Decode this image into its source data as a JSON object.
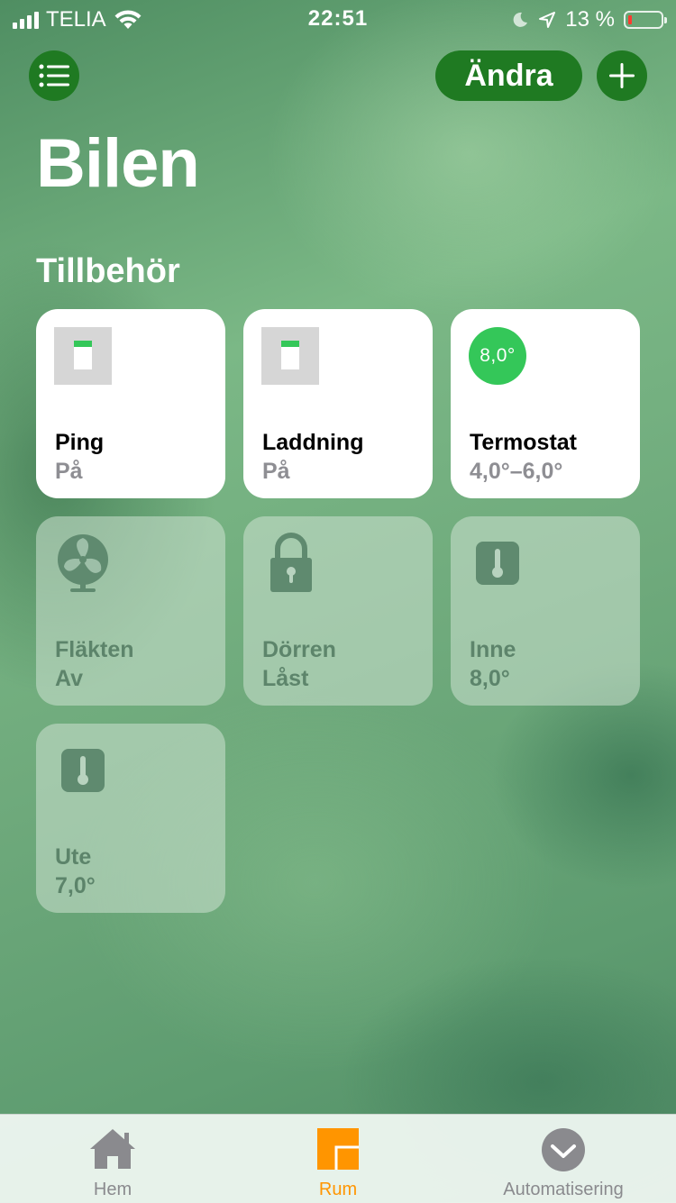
{
  "status_bar": {
    "carrier": "TELIA",
    "time": "22:51",
    "battery": "13 %",
    "battery_level": 0.13
  },
  "header": {
    "menu_icon": "list-icon",
    "edit_label": "Ändra",
    "add_icon": "plus-icon"
  },
  "page": {
    "title": "Bilen",
    "section_title": "Tillbehör"
  },
  "accessories": [
    {
      "name": "Ping",
      "state": "På",
      "icon": "switch-icon",
      "active": true
    },
    {
      "name": "Laddning",
      "state": "På",
      "icon": "switch-icon",
      "active": true
    },
    {
      "name": "Termostat",
      "state": "4,0°–6,0°",
      "icon": "thermostat-badge",
      "badge": "8,0°",
      "active": true
    },
    {
      "name": "Fläkten",
      "state": "Av",
      "icon": "fan-icon",
      "active": false
    },
    {
      "name": "Dörren",
      "state": "Låst",
      "icon": "lock-icon",
      "active": false
    },
    {
      "name": "Inne",
      "state": "8,0°",
      "icon": "thermometer-icon",
      "active": false
    },
    {
      "name": "Ute",
      "state": "7,0°",
      "icon": "thermometer-icon",
      "active": false
    }
  ],
  "tab_bar": {
    "items": [
      {
        "label": "Hem",
        "icon": "house-icon",
        "active": false
      },
      {
        "label": "Rum",
        "icon": "rooms-icon",
        "active": true
      },
      {
        "label": "Automatisering",
        "icon": "clock-check-icon",
        "active": false
      }
    ]
  },
  "colors": {
    "accent_green": "#1f7a22",
    "on_green": "#34c759",
    "active_tab": "#ff9500",
    "battery_low": "#ff3b30"
  }
}
